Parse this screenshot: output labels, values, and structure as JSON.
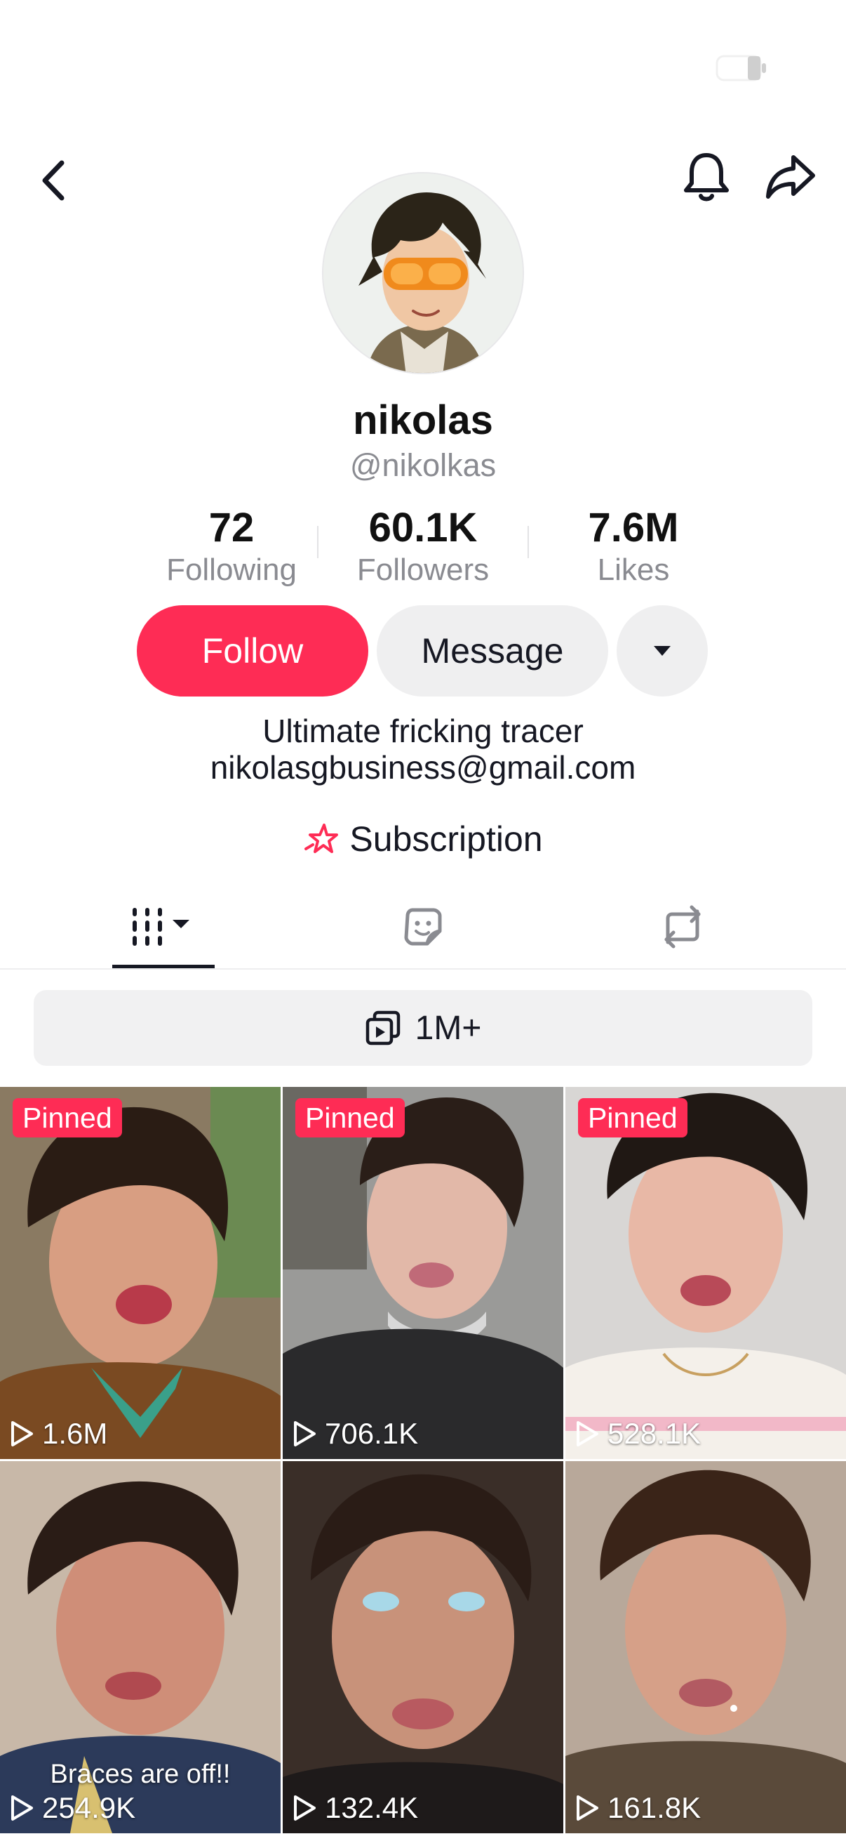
{
  "profile": {
    "display_name": "nikolas",
    "username": "@nikolkas",
    "stats": [
      {
        "value": "72",
        "label": "Following"
      },
      {
        "value": "60.1K",
        "label": "Followers"
      },
      {
        "value": "7.6M",
        "label": "Likes"
      }
    ],
    "bio_line1": "Ultimate fricking tracer",
    "bio_line2": "nikolasgbusiness@gmail.com",
    "subscription_label": "Subscription"
  },
  "actions": {
    "follow_label": "Follow",
    "message_label": "Message"
  },
  "collections": {
    "label": "1M+"
  },
  "icons": {
    "back": "chevron-left-icon",
    "bell": "bell-icon",
    "share": "share-arrow-icon",
    "more": "caret-down-icon",
    "videos_tab": "grid-bars-icon",
    "stickers_tab": "sticker-icon",
    "reposts_tab": "repost-icon"
  },
  "colors": {
    "accent": "#fe2c55",
    "text": "#161823",
    "muted": "#8a8b91",
    "button_bg": "#efeff0"
  },
  "videos": [
    {
      "pinned_label": "Pinned",
      "views": "1.6M",
      "caption": ""
    },
    {
      "pinned_label": "Pinned",
      "views": "706.1K",
      "caption": ""
    },
    {
      "pinned_label": "Pinned",
      "views": "528.1K",
      "caption": ""
    },
    {
      "pinned_label": "",
      "views": "254.9K",
      "caption": "Braces are off!!"
    },
    {
      "pinned_label": "",
      "views": "132.4K",
      "caption": ""
    },
    {
      "pinned_label": "",
      "views": "161.8K",
      "caption": ""
    }
  ]
}
